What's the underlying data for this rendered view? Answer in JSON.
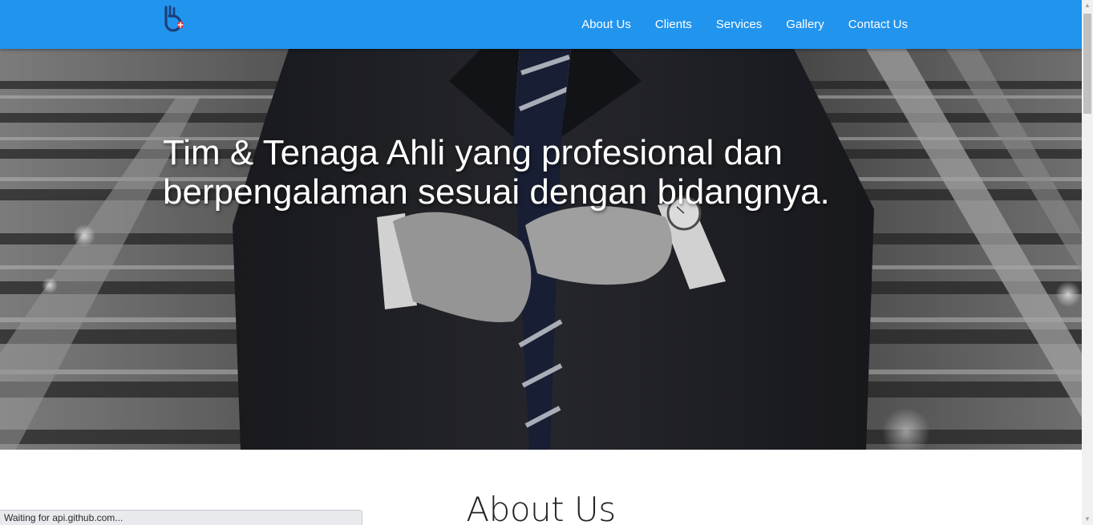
{
  "navbar": {
    "logo_name": "brand-logo",
    "background_color": "#2194ee",
    "links": [
      {
        "label": "About Us"
      },
      {
        "label": "Clients"
      },
      {
        "label": "Services"
      },
      {
        "label": "Gallery"
      },
      {
        "label": "Contact Us"
      }
    ]
  },
  "hero": {
    "title_line1": "Tim & Tenaga Ahli yang profesional dan",
    "title_line2": "berpengalaman sesuai dengan bidangnya.",
    "image": "businessman-in-suit-photo"
  },
  "about": {
    "heading": "About Us"
  },
  "browser": {
    "status_text": "Waiting for api.github.com..."
  }
}
